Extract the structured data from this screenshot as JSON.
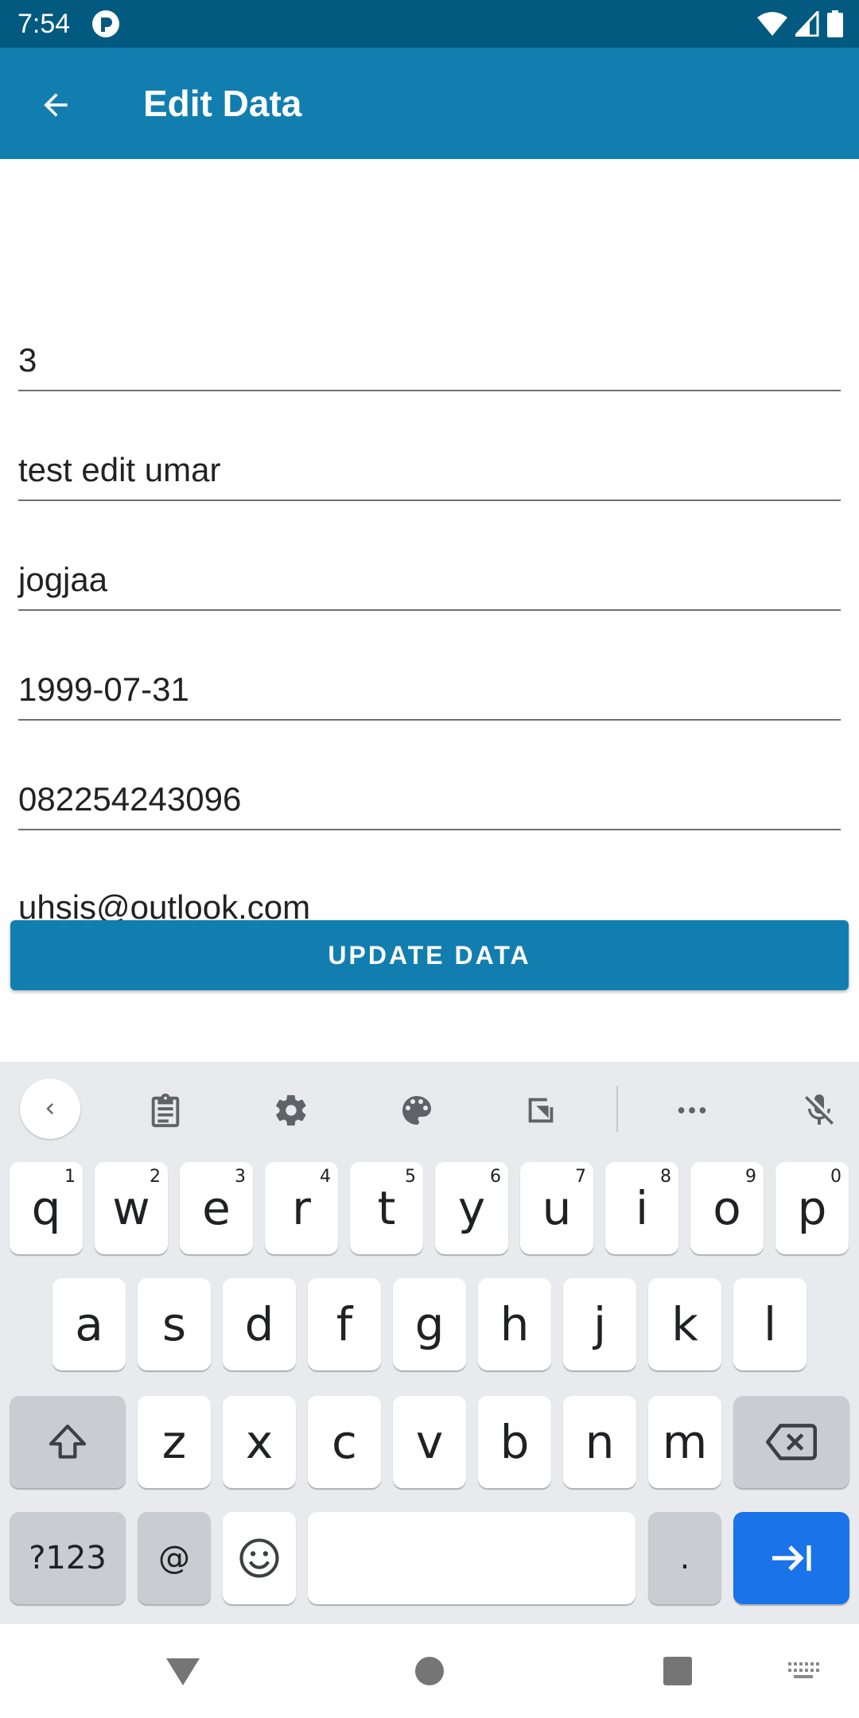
{
  "status_bar": {
    "time": "7:54"
  },
  "app_bar": {
    "title": "Edit Data"
  },
  "form": {
    "fields": [
      {
        "value": "3"
      },
      {
        "value": "test edit umar"
      },
      {
        "value": "jogjaa"
      },
      {
        "value": "1999-07-31"
      },
      {
        "value": "082254243096"
      },
      {
        "value": "uhsis@outlook.com"
      }
    ],
    "update_button_label": "UPDATE DATA"
  },
  "keyboard": {
    "row1": [
      {
        "k": "q",
        "h": "1"
      },
      {
        "k": "w",
        "h": "2"
      },
      {
        "k": "e",
        "h": "3"
      },
      {
        "k": "r",
        "h": "4"
      },
      {
        "k": "t",
        "h": "5"
      },
      {
        "k": "y",
        "h": "6"
      },
      {
        "k": "u",
        "h": "7"
      },
      {
        "k": "i",
        "h": "8"
      },
      {
        "k": "o",
        "h": "9"
      },
      {
        "k": "p",
        "h": "0"
      }
    ],
    "row2": [
      "a",
      "s",
      "d",
      "f",
      "g",
      "h",
      "j",
      "k",
      "l"
    ],
    "row3": [
      "z",
      "x",
      "c",
      "v",
      "b",
      "n",
      "m"
    ],
    "symbols_label": "?123",
    "at_label": "@",
    "period_label": "."
  }
}
